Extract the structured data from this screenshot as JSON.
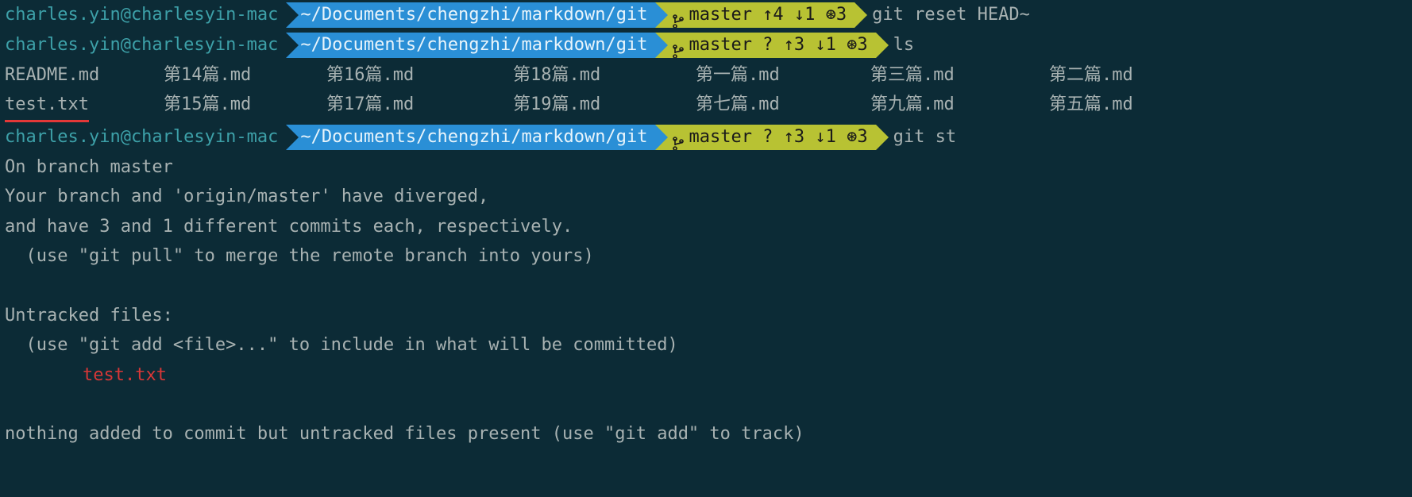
{
  "prompts": [
    {
      "user": "charles.yin@charlesyin-mac",
      "path": "~/Documents/chengzhi/markdown/git",
      "branch": "master ↑4 ↓1 ⊛3",
      "command": "git reset HEAD~"
    },
    {
      "user": "charles.yin@charlesyin-mac",
      "path": "~/Documents/chengzhi/markdown/git",
      "branch": "master ? ↑3 ↓1 ⊛3",
      "command": "ls"
    },
    {
      "user": "charles.yin@charlesyin-mac",
      "path": "~/Documents/chengzhi/markdown/git",
      "branch": "master ? ↑3 ↓1 ⊛3",
      "command": "git st"
    }
  ],
  "ls": {
    "r0c0": "README.md",
    "r0c1": "第14篇.md",
    "r0c2": "第16篇.md",
    "r0c3": "第18篇.md",
    "r0c4": "第一篇.md",
    "r0c5": "第三篇.md",
    "r0c6": "第二篇.md",
    "r1c0": "test.txt",
    "r1c1": "第15篇.md",
    "r1c2": "第17篇.md",
    "r1c3": "第19篇.md",
    "r1c4": "第七篇.md",
    "r1c5": "第九篇.md",
    "r1c6": "第五篇.md"
  },
  "status": {
    "line1": "On branch master",
    "line2": "Your branch and 'origin/master' have diverged,",
    "line3": "and have 3 and 1 different commits each, respectively.",
    "line4": "  (use \"git pull\" to merge the remote branch into yours)",
    "line5": "Untracked files:",
    "line6": "  (use \"git add <file>...\" to include in what will be committed)",
    "line7": "test.txt",
    "line8": "nothing added to commit but untracked files present (use \"git add\" to track)"
  }
}
